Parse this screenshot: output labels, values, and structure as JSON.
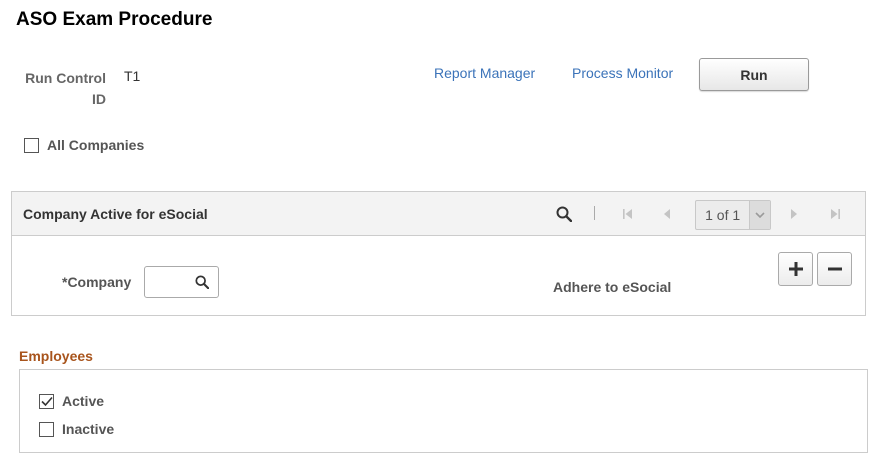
{
  "page": {
    "title": "ASO Exam Procedure"
  },
  "run_control": {
    "label": "Run Control ID",
    "value": "T1"
  },
  "links": {
    "report_manager": "Report Manager",
    "process_monitor": "Process Monitor"
  },
  "run_button": {
    "label": "Run"
  },
  "all_companies": {
    "label": "All Companies",
    "checked": false
  },
  "company_grid": {
    "title": "Company Active for eSocial",
    "pager_text": "1 of 1",
    "company_label": "*Company",
    "company_value": "",
    "adhere_label": "Adhere to eSocial",
    "icons": [
      "search-icon",
      "first-page-icon",
      "previous-page-icon",
      "chevron-down-icon",
      "next-page-icon",
      "last-page-icon",
      "add-row-icon",
      "delete-row-icon"
    ]
  },
  "employees": {
    "title": "Employees",
    "active": {
      "label": "Active",
      "checked": true
    },
    "inactive": {
      "label": "Inactive",
      "checked": false
    }
  },
  "colors": {
    "link": "#3b73b9",
    "section_title": "#a8541c",
    "label": "#555555"
  }
}
